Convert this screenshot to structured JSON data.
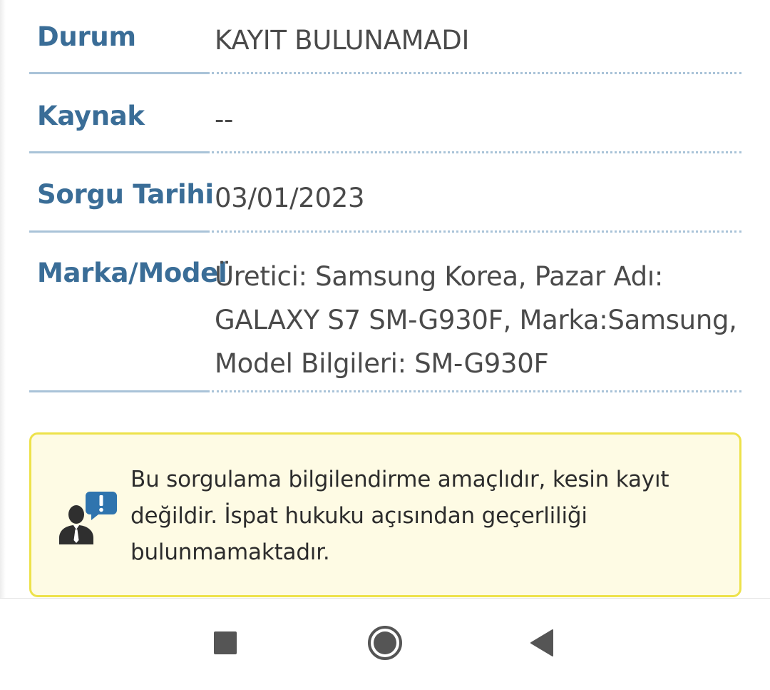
{
  "details": {
    "rows": [
      {
        "label": "Durum",
        "value": "KAYIT BULUNAMADI"
      },
      {
        "label": "Kaynak",
        "value": "--"
      },
      {
        "label": "Sorgu Tarihi",
        "value": "03/01/2023"
      },
      {
        "label": "Marka/Model",
        "value": "Üretici: Samsung Korea, Pazar Adı: GALAXY S7 SM-G930F, Marka:Samsung, Model Bilgileri: SM-G930F"
      }
    ]
  },
  "notice": {
    "icon": "support-agent-alert-icon",
    "text": "Bu sorgulama bilgilendirme amaçlıdır, kesin kayıt değildir. İspat hukuku açısından geçerliliği bulunmamaktadır."
  },
  "navbar": {
    "recents_icon": "square-icon",
    "home_icon": "circle-home-icon",
    "back_icon": "triangle-back-icon"
  },
  "colors": {
    "label": "#3a6d97",
    "value": "#4a4a4a",
    "separator": "#a9c3d8",
    "notice_background": "#fefbe4",
    "notice_border": "#ede24a",
    "nav_icon": "#555555"
  }
}
